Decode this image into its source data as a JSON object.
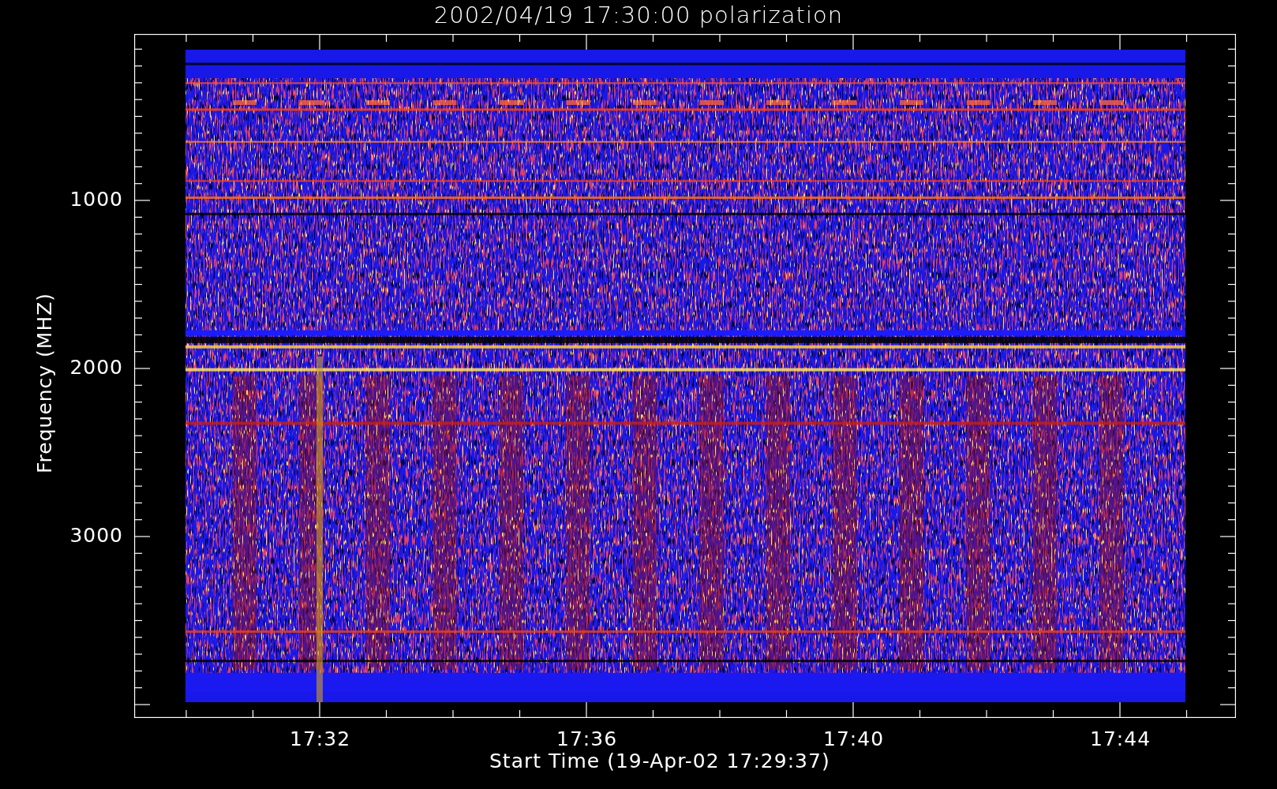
{
  "title": "2002/04/19 17:30:00 polarization",
  "y_axis": {
    "label": "Frequency (MHZ)",
    "ticks": [
      "1000",
      "2000",
      "3000"
    ]
  },
  "x_axis": {
    "label": "Start Time (19-Apr-02 17:29:37)",
    "ticks": [
      "17:32",
      "17:36",
      "17:40",
      "17:44"
    ]
  }
}
